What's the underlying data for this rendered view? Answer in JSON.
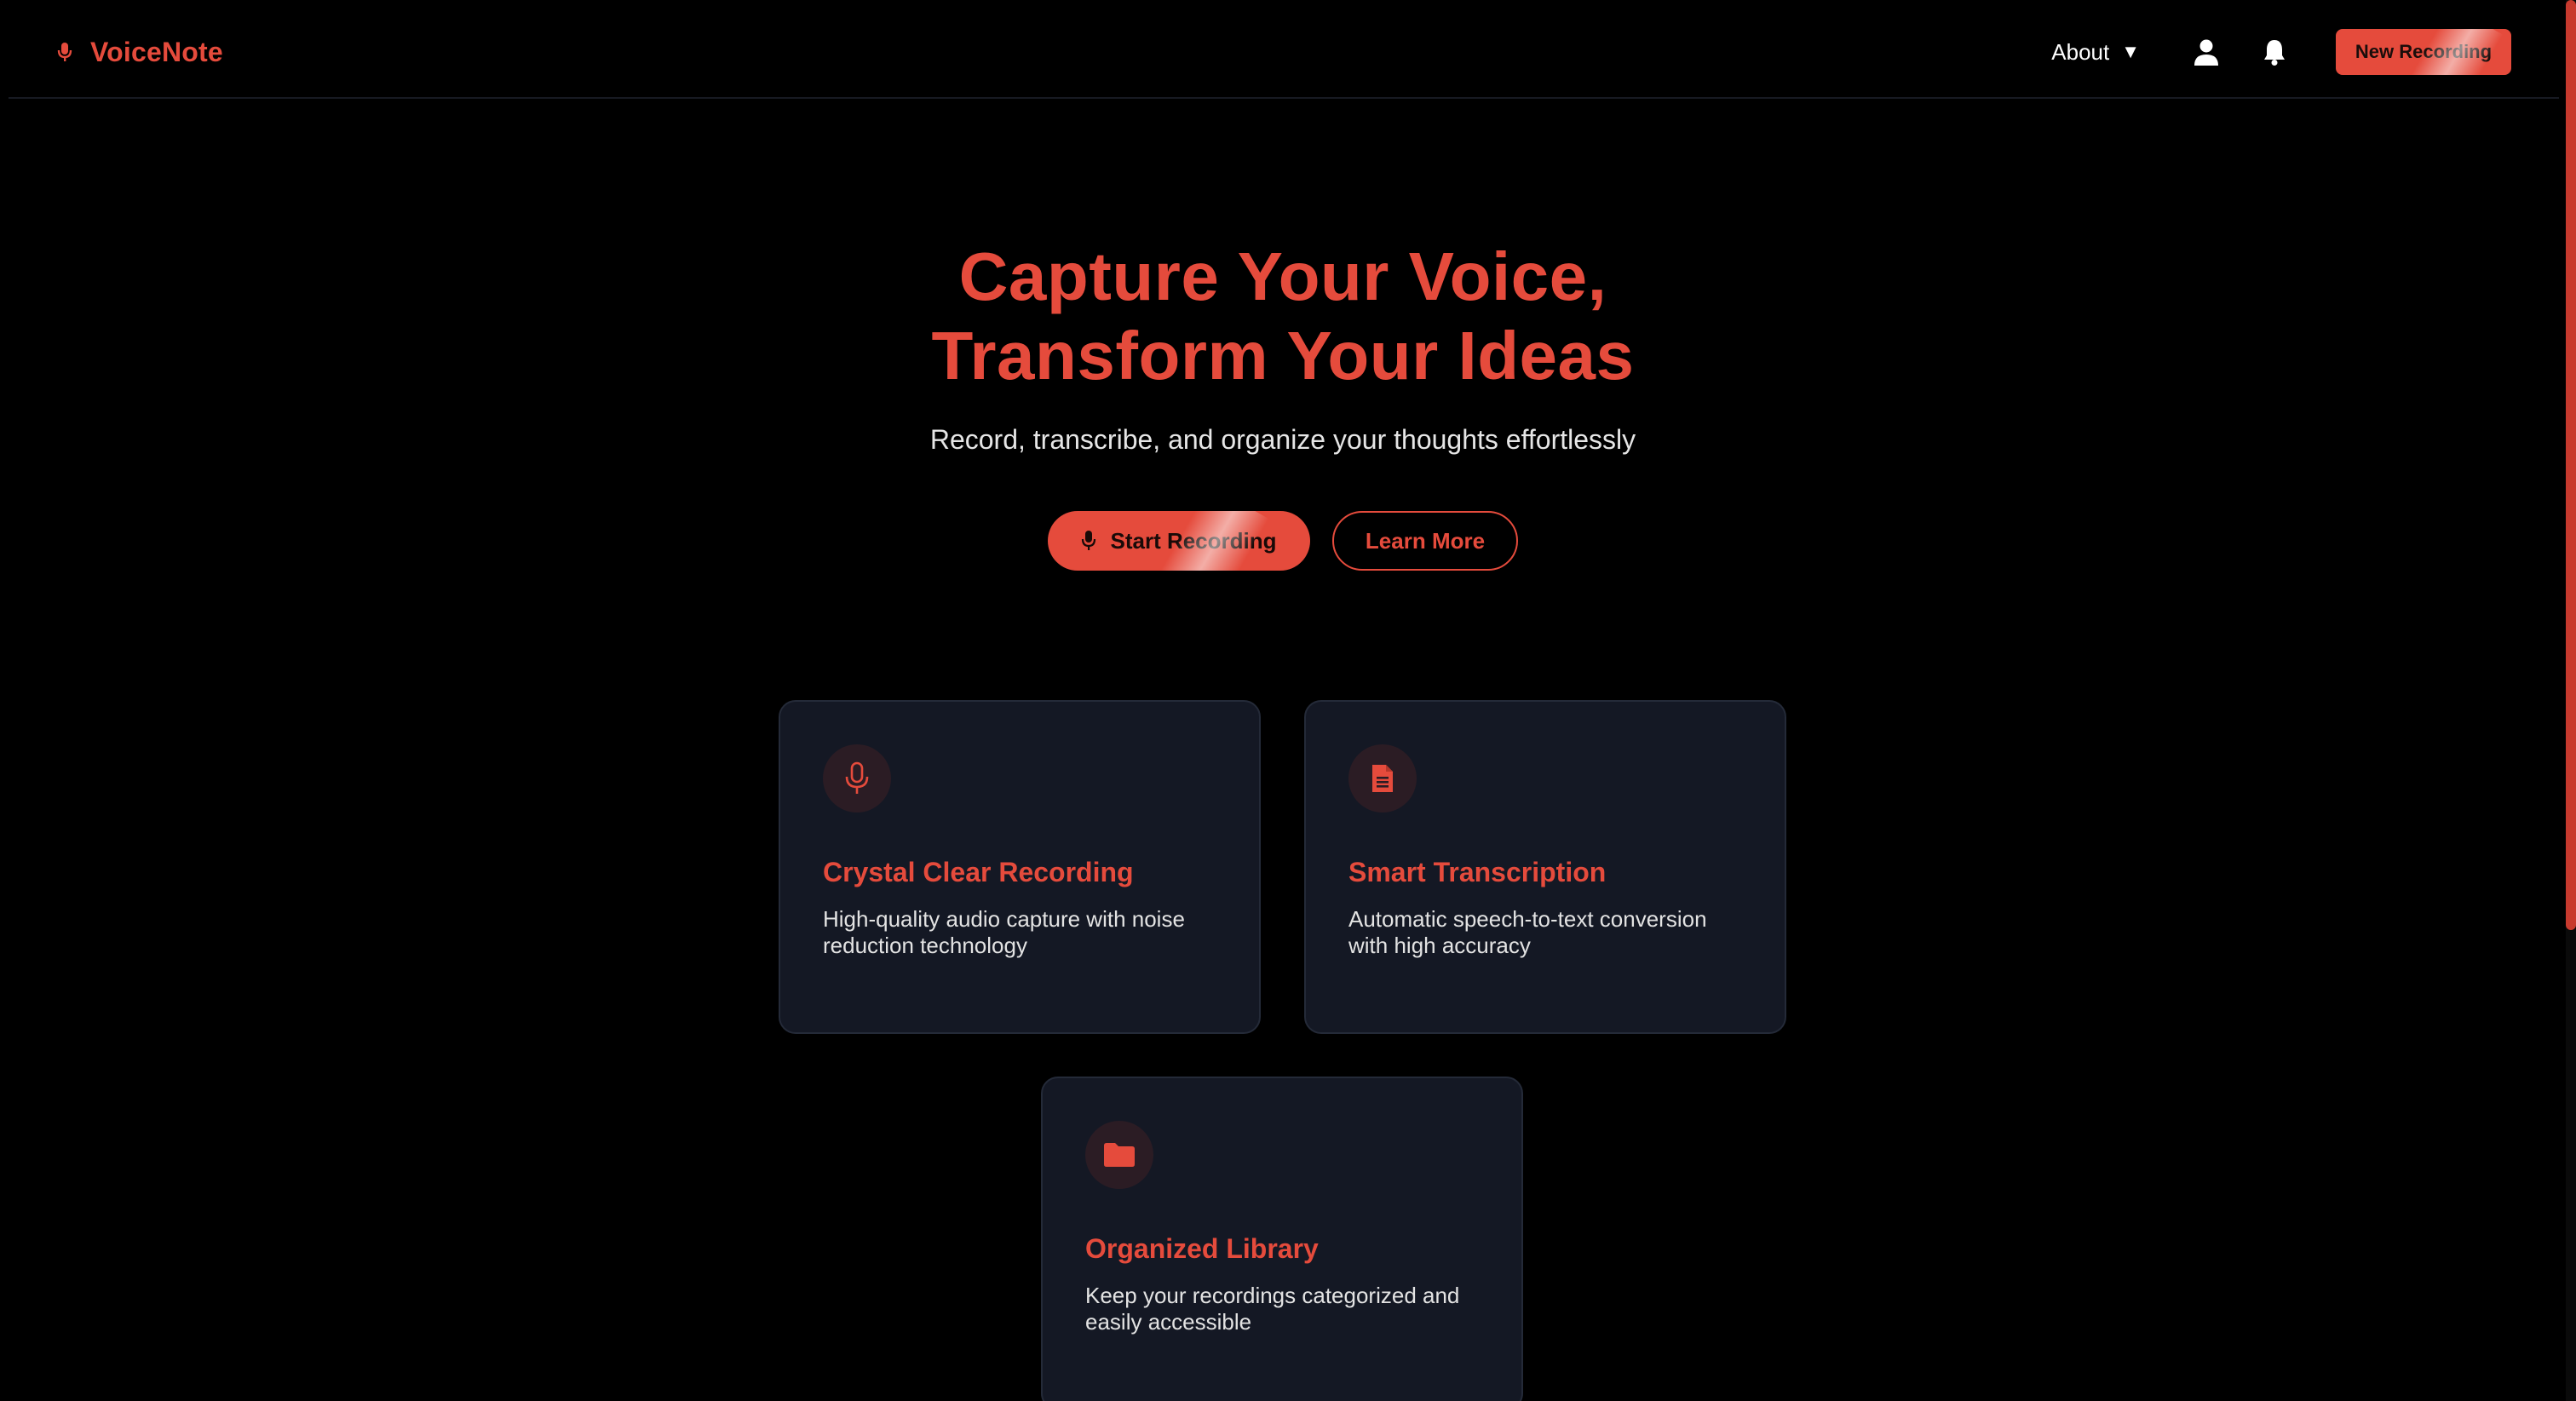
{
  "nav": {
    "brand": "VoiceNote",
    "brand_icon": "microphone-icon",
    "about_label": "About",
    "about_caret": "▼",
    "user_icon": "user-icon",
    "bell_icon": "bell-icon",
    "new_recording_label": "New Recording"
  },
  "hero": {
    "title_line1": "Capture Your Voice,",
    "title_line2": "Transform Your Ideas",
    "subtitle": "Record, transcribe, and organize your thoughts effortlessly",
    "start_label": "Start Recording",
    "start_icon": "microphone-icon",
    "learn_label": "Learn More"
  },
  "features": [
    {
      "icon": "microphone-outline-icon",
      "title": "Crystal Clear Recording",
      "description": "High-quality audio capture with noise reduction technology"
    },
    {
      "icon": "document-icon",
      "title": "Smart Transcription",
      "description": "Automatic speech-to-text conversion with high accuracy"
    },
    {
      "icon": "folder-icon",
      "title": "Organized Library",
      "description": "Keep your recordings categorized and easily accessible"
    }
  ],
  "colors": {
    "accent": "#e54b3c",
    "background": "#000000",
    "card_background": "#141824",
    "icon_circle": "#2b1c24"
  }
}
